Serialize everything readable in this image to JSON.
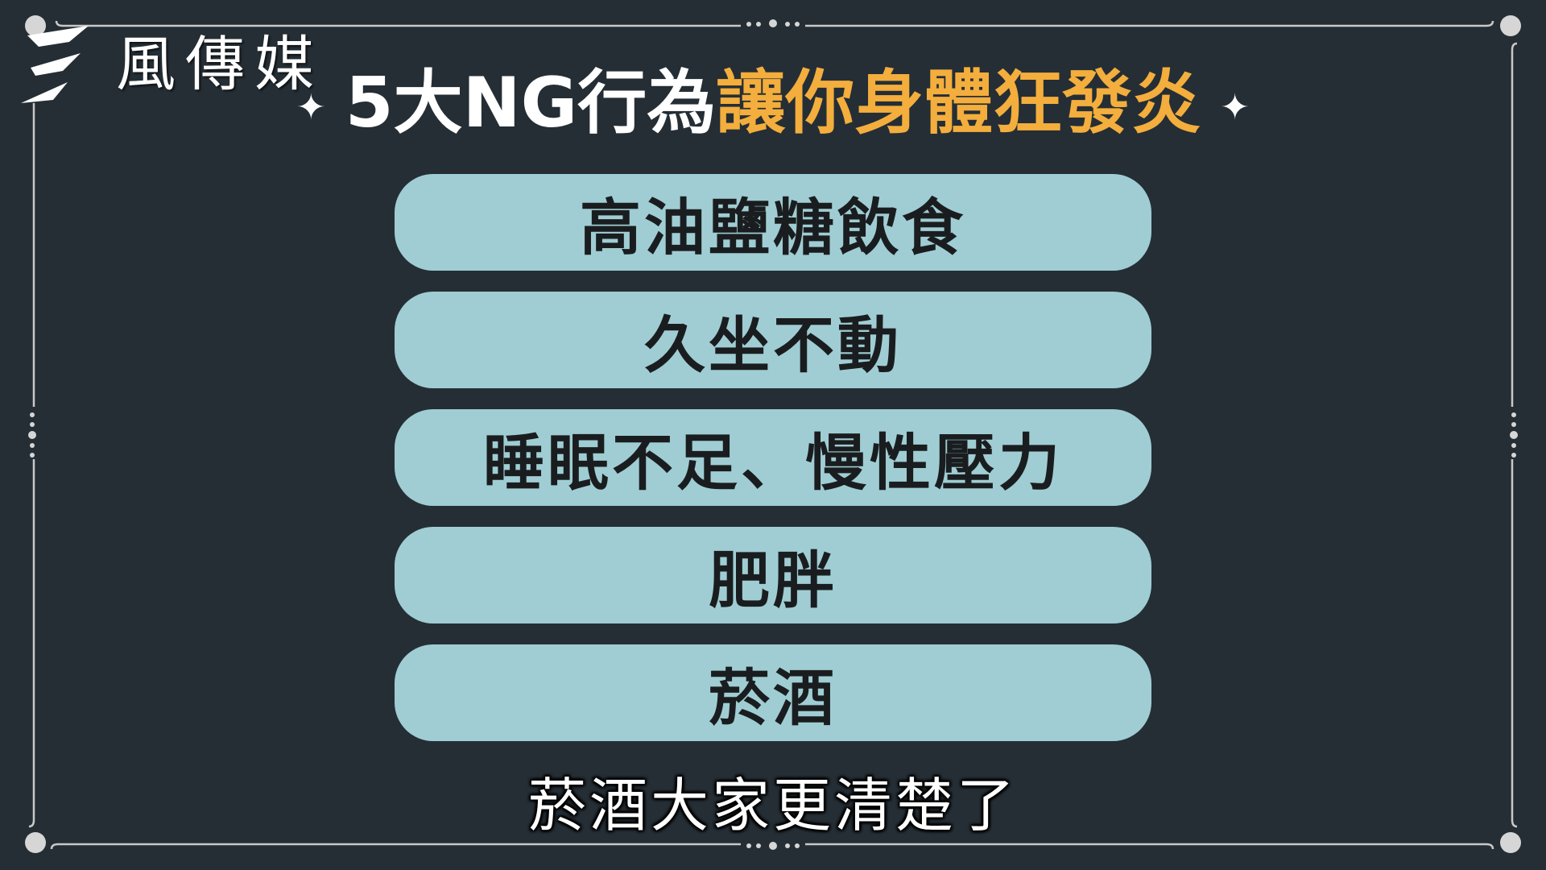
{
  "brand": {
    "name": "風傳媒"
  },
  "title": {
    "prefix": "5大NG行為",
    "highlight": "讓你身體狂發炎",
    "sparkle_left": "✦",
    "sparkle_right": "✦"
  },
  "items": [
    {
      "label": "高油鹽糖飲食"
    },
    {
      "label": "久坐不動"
    },
    {
      "label": "睡眠不足、慢性壓力"
    },
    {
      "label": "肥胖"
    },
    {
      "label": "菸酒"
    }
  ],
  "subtitle": "菸酒大家更清楚了",
  "colors": {
    "background": "#252e35",
    "accent": "#f3ae3d",
    "pill": "#9fcdd3",
    "frame": "#c9c9c9"
  }
}
